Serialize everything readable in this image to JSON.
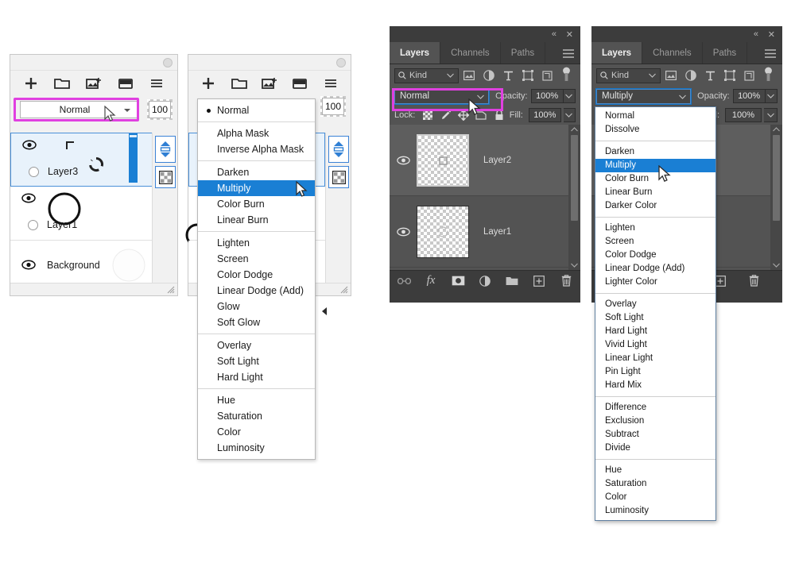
{
  "meta": {
    "accent_magenta": "#e040e0",
    "accent_blue": "#1a7fd4",
    "ps_panel_bg": "#3c3c3c",
    "ps_list_bg": "#535353"
  },
  "panel1": {
    "name": "layers-panel-light",
    "blend_mode": "Normal",
    "opacity_value": "100",
    "toolbar_icons": [
      "new-layer-icon",
      "new-folder-icon",
      "new-image-layer-icon",
      "mask-icon",
      "menu-icon"
    ],
    "layers": [
      {
        "name": "Layer3",
        "visible": true,
        "selected": true
      },
      {
        "name": "Layer1",
        "visible": true,
        "selected": false
      },
      {
        "name": "Background",
        "visible": true,
        "selected": false
      }
    ]
  },
  "panel2": {
    "name": "layers-panel-light-dropdown-open",
    "opacity_value": "100",
    "toolbar_icons": [
      "new-layer-icon",
      "new-folder-icon",
      "new-image-layer-icon",
      "mask-icon",
      "menu-icon"
    ],
    "menu": {
      "highlighted": "Multiply",
      "checked": "Normal",
      "groups": [
        [
          "Normal"
        ],
        [
          "Alpha Mask",
          "Inverse Alpha Mask"
        ],
        [
          "Darken",
          "Multiply",
          "Color Burn",
          "Linear Burn"
        ],
        [
          "Lighten",
          "Screen",
          "Color Dodge",
          "Linear Dodge (Add)",
          "Glow",
          "Soft Glow"
        ],
        [
          "Overlay",
          "Soft Light",
          "Hard Light"
        ],
        [
          "Hue",
          "Saturation",
          "Color",
          "Luminosity"
        ]
      ]
    }
  },
  "panel3": {
    "name": "photoshop-layers-panel-normal",
    "tabs": [
      {
        "label": "Layers",
        "active": true
      },
      {
        "label": "Channels",
        "active": false
      },
      {
        "label": "Paths",
        "active": false
      }
    ],
    "filter": {
      "label": "Kind",
      "icons": [
        "pixel-filter-icon",
        "adjustment-filter-icon",
        "type-filter-icon",
        "shape-filter-icon",
        "smartobject-filter-icon",
        "filter-toggle-icon"
      ]
    },
    "blend_mode": "Normal",
    "opacity_label": "Opacity:",
    "opacity_value": "100%",
    "lock_label": "Lock:",
    "lock_icons": [
      "lock-transparent-pixels-icon",
      "lock-image-pixels-icon",
      "lock-position-icon",
      "lock-artboard-nesting-icon",
      "lock-all-icon"
    ],
    "fill_label": "Fill:",
    "fill_value": "100%",
    "layers": [
      {
        "name": "Layer2",
        "visible": true,
        "selected": true
      },
      {
        "name": "Layer1",
        "visible": true,
        "selected": false
      }
    ],
    "bottom_icons": [
      "link-layers-icon",
      "layer-style-fx-icon",
      "add-mask-icon",
      "adjustment-layer-icon",
      "new-group-icon",
      "new-layer-icon",
      "delete-layer-icon"
    ],
    "window_controls": [
      "collapse-icon",
      "close-icon"
    ]
  },
  "panel4": {
    "name": "photoshop-layers-panel-multiply",
    "tabs": [
      {
        "label": "Layers",
        "active": true
      },
      {
        "label": "Channels",
        "active": false
      },
      {
        "label": "Paths",
        "active": false
      }
    ],
    "filter": {
      "label": "Kind"
    },
    "blend_mode": "Multiply",
    "opacity_label": "Opacity:",
    "opacity_value": "100%",
    "fill_label": "Fill:",
    "fill_value": "100%",
    "bottom_icons": [
      "new-layer-icon",
      "delete-layer-icon"
    ],
    "window_controls": [
      "collapse-icon",
      "close-icon"
    ],
    "menu": {
      "highlighted": "Multiply",
      "groups": [
        [
          "Normal",
          "Dissolve"
        ],
        [
          "Darken",
          "Multiply",
          "Color Burn",
          "Linear Burn",
          "Darker Color"
        ],
        [
          "Lighten",
          "Screen",
          "Color Dodge",
          "Linear Dodge (Add)",
          "Lighter Color"
        ],
        [
          "Overlay",
          "Soft Light",
          "Hard Light",
          "Vivid Light",
          "Linear Light",
          "Pin Light",
          "Hard Mix"
        ],
        [
          "Difference",
          "Exclusion",
          "Subtract",
          "Divide"
        ],
        [
          "Hue",
          "Saturation",
          "Color",
          "Luminosity"
        ]
      ]
    }
  }
}
